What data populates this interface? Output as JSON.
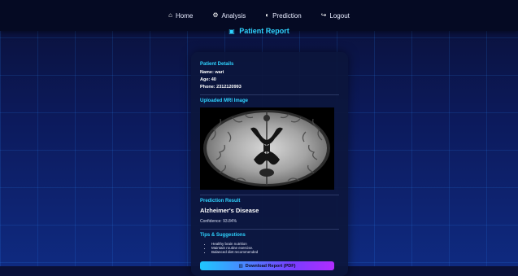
{
  "navbar": {
    "items": [
      {
        "icon": "home-icon",
        "glyph": "⌂",
        "label": "Home"
      },
      {
        "icon": "gears-icon",
        "glyph": "⚙",
        "label": "Analysis"
      },
      {
        "icon": "brain-icon",
        "glyph": "◐",
        "label": "Prediction"
      },
      {
        "icon": "logout-icon",
        "glyph": "↪",
        "label": "Logout"
      }
    ]
  },
  "page": {
    "title_icon": "report-icon",
    "title": "Patient Report"
  },
  "report": {
    "patient_details_title": "Patient Details",
    "name_line": "Name: wari",
    "age_line": "Age: 40",
    "phone_line": "Phone: 2312120993",
    "mri_title": "Uploaded MRI Image",
    "prediction_title": "Prediction Result",
    "prediction": "Alzheimer's Disease",
    "confidence": "Confidence: 93.84%",
    "tips_title": "Tips & Suggestions",
    "tips": [
      "Healthy brain nutrition",
      "Maintain routine exercise.",
      "Balanced diet recommended"
    ],
    "download_label": "Download Report (PDF)",
    "download_icon": "chart-icon"
  },
  "colors": {
    "accent": "#2fd3ff",
    "background": "#0c1a5c",
    "navbar": "#050a23",
    "button_start": "#1ec8ff",
    "button_end": "#b12cff"
  }
}
